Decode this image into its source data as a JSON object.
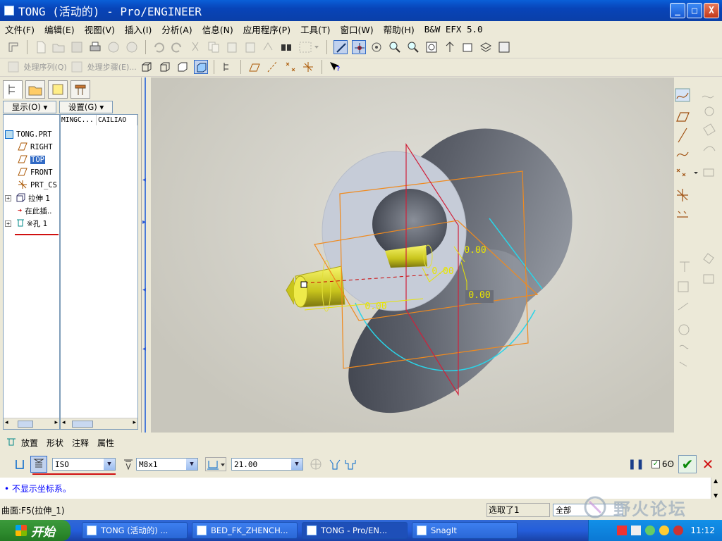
{
  "window": {
    "title": "TONG (活动的) - Pro/ENGINEER",
    "controls": [
      "_",
      "□",
      "X"
    ]
  },
  "menu": [
    "文件(F)",
    "编辑(E)",
    "视图(V)",
    "插入(I)",
    "分析(A)",
    "信息(N)",
    "应用程序(P)",
    "工具(T)",
    "窗口(W)",
    "帮助(H)",
    "B&W EFX 5.0"
  ],
  "toolbar2": {
    "process_sequence": "处理序列(Q)",
    "process_step": "处理步骤(E)..."
  },
  "model_tree": {
    "show_label": "显示(O)",
    "settings_label": "设置(G)",
    "columns": [
      "MINGC...",
      "CAILIAO"
    ],
    "items": [
      {
        "label": "TONG.PRT",
        "icon": "part-icon"
      },
      {
        "label": "RIGHT",
        "icon": "datum-plane-icon"
      },
      {
        "label": "TOP",
        "icon": "datum-plane-icon",
        "selected": true
      },
      {
        "label": "FRONT",
        "icon": "datum-plane-icon"
      },
      {
        "label": "PRT_CS",
        "icon": "coordinate-system-icon"
      },
      {
        "label": "拉伸 1",
        "icon": "extrude-icon"
      },
      {
        "label": "在此插..",
        "icon": "insert-here-icon"
      },
      {
        "label": "※孔 1",
        "icon": "hole-icon"
      }
    ]
  },
  "viewport": {
    "dim_labels": [
      "0.00",
      "0.00",
      "0.00",
      "0.00"
    ],
    "accent_cyan": "#2ad4e8",
    "accent_orange": "#f08a1e",
    "accent_yellow": "#d8d820",
    "datum_red": "#d0203a"
  },
  "dashboard": {
    "tabs": [
      "放置",
      "形状",
      "注释",
      "属性"
    ],
    "standard": "ISO",
    "screw_size": "M8x1",
    "depth": "21.00"
  },
  "message": "• 不显示坐标系。",
  "status": {
    "left": "曲面:F5(拉伸_1)",
    "selected": "选取了1",
    "filter": "全部"
  },
  "taskbar": {
    "start": "开始",
    "tasks": [
      "TONG (活动的) ...",
      "BED_FK_ZHENCH...",
      "TONG - Pro/EN...",
      "SnagIt"
    ],
    "clock": "11:12",
    "watermark": "野火论坛"
  }
}
